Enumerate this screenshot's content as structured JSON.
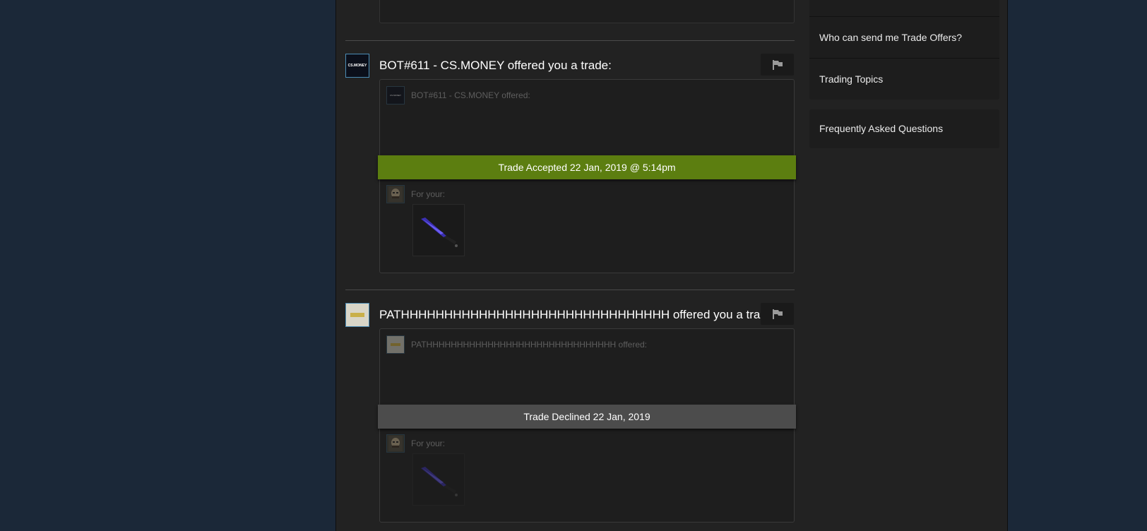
{
  "sidebar": {
    "items": [
      {
        "label": "Who can send me Trade Offers?"
      },
      {
        "label": "Trading Topics"
      },
      {
        "label": "Frequently Asked Questions"
      }
    ]
  },
  "trades": [
    {
      "partner": "BOT#611 - CS.MONEY",
      "title": "BOT#611 - CS.MONEY offered you a trade:",
      "offered_label": "BOT#611 - CS.MONEY offered:",
      "status": "Trade Accepted 22 Jan, 2019 @ 5:14pm",
      "status_type": "accepted",
      "for_label": "For your:",
      "avatar_text": "CS.MONEY",
      "item_icon": "knife-icon"
    },
    {
      "partner": "PATHHHHHHHHHHHHHHHHHHHHHHHHHHHHH",
      "title": "PATHHHHHHHHHHHHHHHHHHHHHHHHHHHHHHH offered you a trade:",
      "offered_label": "PATHHHHHHHHHHHHHHHHHHHHHHHHHHHHHHH offered:",
      "status": "Trade Declined 22 Jan, 2019",
      "status_type": "declined",
      "for_label": "For your:",
      "item_icon": "knife-icon"
    }
  ],
  "colors": {
    "page_bg": "#1b2838",
    "content_bg": "#222222",
    "accepted": "#5c7e10",
    "declined": "#4c4c4c",
    "avatar_border": "#4b8cb4"
  }
}
